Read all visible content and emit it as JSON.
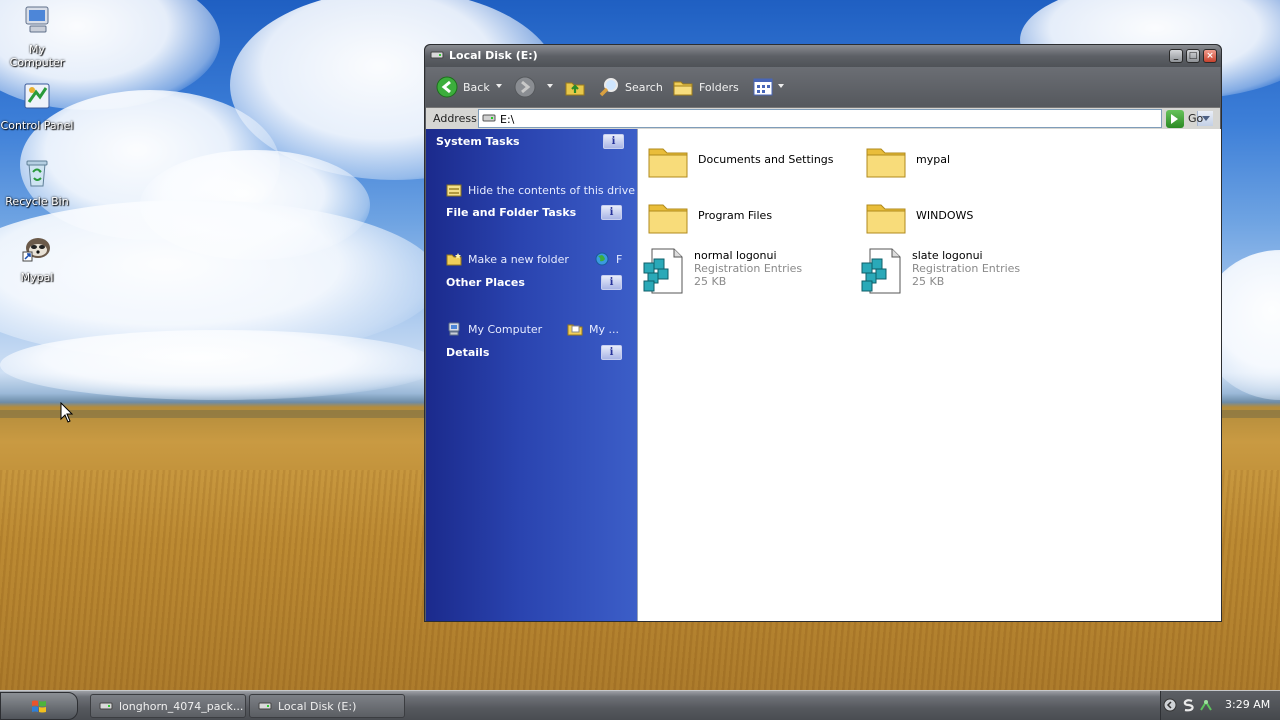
{
  "desktop": {
    "icons": [
      {
        "label": "My Computer",
        "icon": "my-computer-icon"
      },
      {
        "label": "Control Panel",
        "icon": "control-panel-icon"
      },
      {
        "label": "Recycle Bin",
        "icon": "recycle-bin-icon"
      },
      {
        "label": "Mypal",
        "icon": "mypal-icon"
      }
    ]
  },
  "window": {
    "title": "Local Disk (E:)",
    "toolbar": {
      "back_label": "Back",
      "search_label": "Search",
      "folders_label": "Folders"
    },
    "address": {
      "label": "Address",
      "value": "E:\\",
      "go_label": "Go"
    },
    "taskpane": {
      "system_tasks": "System Tasks",
      "hide_contents": "Hide the contents of this drive",
      "file_folder_tasks": "File and Folder Tasks",
      "make_new_folder": "Make a new folder",
      "publish_truncated": "F",
      "other_places": "Other Places",
      "my_computer": "My Computer",
      "my_documents_truncated": "My ...",
      "details": "Details",
      "info_glyph": "i"
    },
    "files": [
      {
        "name": "Documents and Settings",
        "type": "folder"
      },
      {
        "name": "mypal",
        "type": "folder"
      },
      {
        "name": "Program Files",
        "type": "folder"
      },
      {
        "name": "WINDOWS",
        "type": "folder"
      },
      {
        "name": "normal logonui",
        "type": "registry",
        "kind": "Registration Entries",
        "size": "25 KB"
      },
      {
        "name": "slate logonui",
        "type": "registry",
        "kind": "Registration Entries",
        "size": "25 KB"
      }
    ]
  },
  "taskbar": {
    "tasks": [
      {
        "label": "longhorn_4074_pack...",
        "icon": "drive-icon"
      },
      {
        "label": "Local Disk (E:)",
        "icon": "drive-icon"
      }
    ],
    "clock": "3:29 AM"
  },
  "colors": {
    "taskpane_blue": "#2a44b0",
    "chrome_gray": "#5a5d63",
    "folder_yellow": "#f3cf5a"
  }
}
